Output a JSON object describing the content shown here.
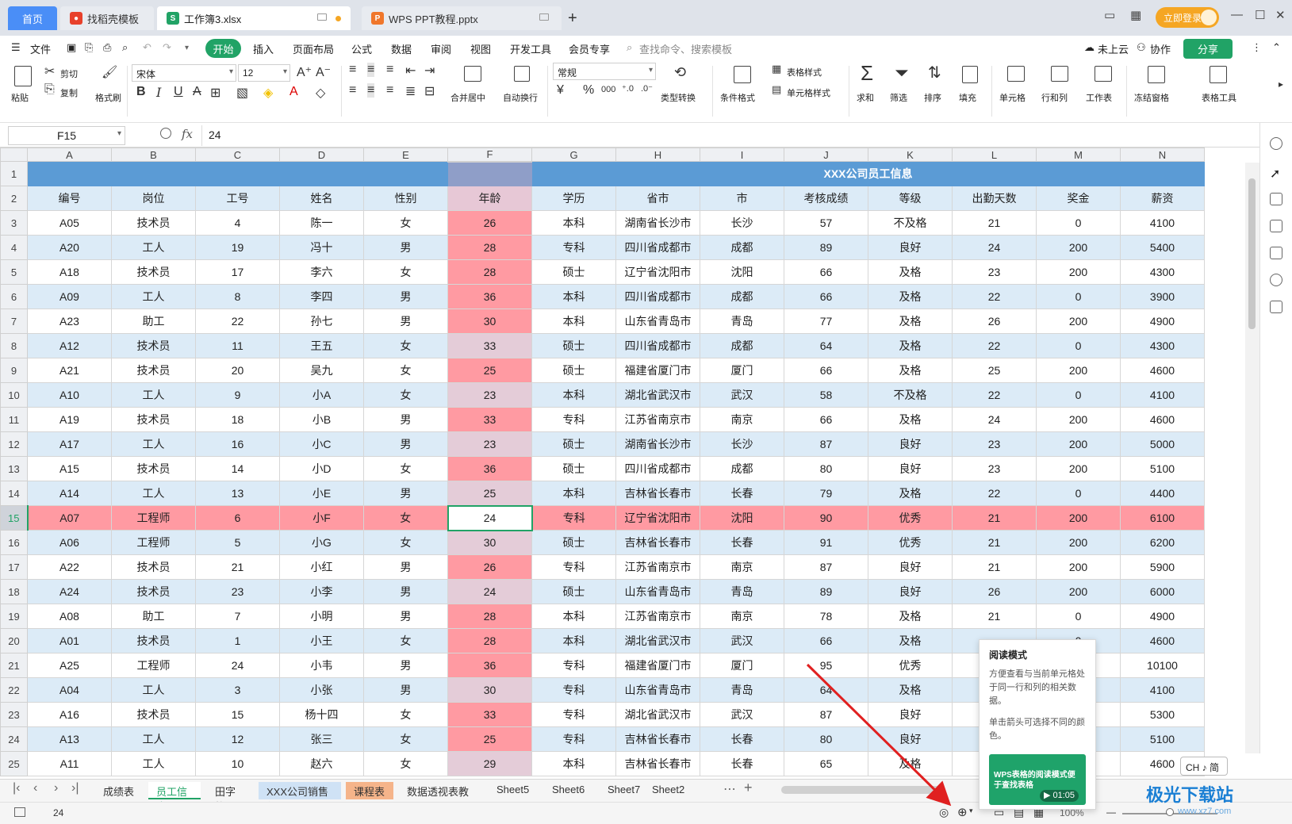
{
  "window": {
    "tabs": [
      {
        "label": "首页"
      },
      {
        "label": "找稻壳模板"
      },
      {
        "label": "工作簿3.xlsx"
      },
      {
        "label": "WPS PPT教程.pptx"
      }
    ],
    "login_label": "立即登录",
    "controls": [
      "▭",
      "▦",
      "—",
      "☐",
      "✕"
    ]
  },
  "menu": {
    "file": "文件",
    "items": [
      "开始",
      "插入",
      "页面布局",
      "公式",
      "数据",
      "审阅",
      "视图",
      "开发工具",
      "会员专享"
    ],
    "search_placeholder": "查找命令、搜索模板",
    "cloud": "未上云",
    "collab": "协作",
    "share": "分享"
  },
  "ribbon": {
    "paste": "粘贴",
    "cut": "剪切",
    "copy": "复制",
    "format_painter": "格式刷",
    "font_name": "宋体",
    "font_size": "12",
    "bold": "B",
    "italic": "I",
    "underline": "U",
    "strike": "A",
    "merge": "合并居中",
    "wrap": "自动换行",
    "number_format": "常规",
    "currency": "¥",
    "percent": "%",
    "thousands": "000",
    "type_convert": "类型转换",
    "conditional": "条件格式",
    "table_style": "表格样式",
    "cell_style": "单元格样式",
    "sum": "求和",
    "filter": "筛选",
    "sort": "排序",
    "fill": "填充",
    "cell": "单元格",
    "rowcol": "行和列",
    "worksheet": "工作表",
    "freeze": "冻结窗格",
    "table_tools": "表格工具"
  },
  "formula_bar": {
    "name_box": "F15",
    "fx": "fx",
    "value": "24"
  },
  "columns": [
    "A",
    "B",
    "C",
    "D",
    "E",
    "F",
    "G",
    "H",
    "I",
    "J",
    "K",
    "L",
    "M",
    "N"
  ],
  "table": {
    "title": "XXX公司员工信息",
    "headers": [
      "编号",
      "岗位",
      "工号",
      "姓名",
      "性别",
      "年龄",
      "学历",
      "省市",
      "市",
      "考核成绩",
      "等级",
      "出勤天数",
      "奖金",
      "薪资"
    ],
    "rows": [
      [
        "A05",
        "技术员",
        "4",
        "陈一",
        "女",
        "26",
        "本科",
        "湖南省长沙市",
        "长沙",
        "57",
        "不及格",
        "21",
        "0",
        "4100"
      ],
      [
        "A20",
        "工人",
        "19",
        "冯十",
        "男",
        "28",
        "专科",
        "四川省成都市",
        "成都",
        "89",
        "良好",
        "24",
        "200",
        "5400"
      ],
      [
        "A18",
        "技术员",
        "17",
        "李六",
        "女",
        "28",
        "硕士",
        "辽宁省沈阳市",
        "沈阳",
        "66",
        "及格",
        "23",
        "200",
        "4300"
      ],
      [
        "A09",
        "工人",
        "8",
        "李四",
        "男",
        "36",
        "本科",
        "四川省成都市",
        "成都",
        "66",
        "及格",
        "22",
        "0",
        "3900"
      ],
      [
        "A23",
        "助工",
        "22",
        "孙七",
        "男",
        "30",
        "本科",
        "山东省青岛市",
        "青岛",
        "77",
        "及格",
        "26",
        "200",
        "4900"
      ],
      [
        "A12",
        "技术员",
        "11",
        "王五",
        "女",
        "33",
        "硕士",
        "四川省成都市",
        "成都",
        "64",
        "及格",
        "22",
        "0",
        "4300"
      ],
      [
        "A21",
        "技术员",
        "20",
        "吴九",
        "女",
        "25",
        "硕士",
        "福建省厦门市",
        "厦门",
        "66",
        "及格",
        "25",
        "200",
        "4600"
      ],
      [
        "A10",
        "工人",
        "9",
        "小A",
        "女",
        "23",
        "本科",
        "湖北省武汉市",
        "武汉",
        "58",
        "不及格",
        "22",
        "0",
        "4100"
      ],
      [
        "A19",
        "技术员",
        "18",
        "小B",
        "男",
        "33",
        "专科",
        "江苏省南京市",
        "南京",
        "66",
        "及格",
        "24",
        "200",
        "4600"
      ],
      [
        "A17",
        "工人",
        "16",
        "小C",
        "男",
        "23",
        "硕士",
        "湖南省长沙市",
        "长沙",
        "87",
        "良好",
        "23",
        "200",
        "5000"
      ],
      [
        "A15",
        "技术员",
        "14",
        "小D",
        "女",
        "36",
        "硕士",
        "四川省成都市",
        "成都",
        "80",
        "良好",
        "23",
        "200",
        "5100"
      ],
      [
        "A14",
        "工人",
        "13",
        "小E",
        "男",
        "25",
        "本科",
        "吉林省长春市",
        "长春",
        "79",
        "及格",
        "22",
        "0",
        "4400"
      ],
      [
        "A07",
        "工程师",
        "6",
        "小F",
        "女",
        "24",
        "专科",
        "辽宁省沈阳市",
        "沈阳",
        "90",
        "优秀",
        "21",
        "200",
        "6100"
      ],
      [
        "A06",
        "工程师",
        "5",
        "小G",
        "女",
        "30",
        "硕士",
        "吉林省长春市",
        "长春",
        "91",
        "优秀",
        "21",
        "200",
        "6200"
      ],
      [
        "A22",
        "技术员",
        "21",
        "小红",
        "男",
        "26",
        "专科",
        "江苏省南京市",
        "南京",
        "87",
        "良好",
        "21",
        "200",
        "5900"
      ],
      [
        "A24",
        "技术员",
        "23",
        "小李",
        "男",
        "24",
        "硕士",
        "山东省青岛市",
        "青岛",
        "89",
        "良好",
        "26",
        "200",
        "6000"
      ],
      [
        "A08",
        "助工",
        "7",
        "小明",
        "男",
        "28",
        "本科",
        "江苏省南京市",
        "南京",
        "78",
        "及格",
        "21",
        "0",
        "4900"
      ],
      [
        "A01",
        "技术员",
        "1",
        "小王",
        "女",
        "28",
        "本科",
        "湖北省武汉市",
        "武汉",
        "66",
        "及格",
        "",
        "0",
        "4600"
      ],
      [
        "A25",
        "工程师",
        "24",
        "小韦",
        "男",
        "36",
        "专科",
        "福建省厦门市",
        "厦门",
        "95",
        "优秀",
        "",
        "200",
        "10100"
      ],
      [
        "A04",
        "工人",
        "3",
        "小张",
        "男",
        "30",
        "专科",
        "山东省青岛市",
        "青岛",
        "64",
        "及格",
        "",
        "0",
        "4100"
      ],
      [
        "A16",
        "技术员",
        "15",
        "杨十四",
        "女",
        "33",
        "专科",
        "湖北省武汉市",
        "武汉",
        "87",
        "良好",
        "",
        "200",
        "5300"
      ],
      [
        "A13",
        "工人",
        "12",
        "张三",
        "女",
        "25",
        "专科",
        "吉林省长春市",
        "长春",
        "80",
        "良好",
        "",
        "200",
        "5100"
      ],
      [
        "A11",
        "工人",
        "10",
        "赵六",
        "女",
        "29",
        "本科",
        "吉林省长春市",
        "长春",
        "65",
        "及格",
        "",
        "0",
        "4600"
      ]
    ],
    "pink_age_rows": [
      1,
      2,
      3,
      4,
      5,
      7,
      9,
      11,
      15,
      17,
      18,
      19,
      21,
      22
    ]
  },
  "sheet_tabs": [
    "成绩表",
    "员工信息",
    "田字格",
    "XXX公司销售额",
    "课程表",
    "数据透视表教程",
    "Sheet5",
    "Sheet6",
    "Sheet7",
    "Sheet2"
  ],
  "active_sheet": "员工信息",
  "status": {
    "value": "24",
    "zoom": "100%"
  },
  "tooltip": {
    "title": "阅读模式",
    "desc": "方便查看与当前单元格处于同一行和列的相关数据。",
    "hint": "单击箭头可选择不同的颜色。",
    "video_title": "WPS表格的阅读模式便于查找表格",
    "video_duration": "01:05"
  },
  "ime": "CH ♪ 简",
  "watermark": {
    "main": "极光下载站",
    "sub": "www.xz7.com"
  }
}
